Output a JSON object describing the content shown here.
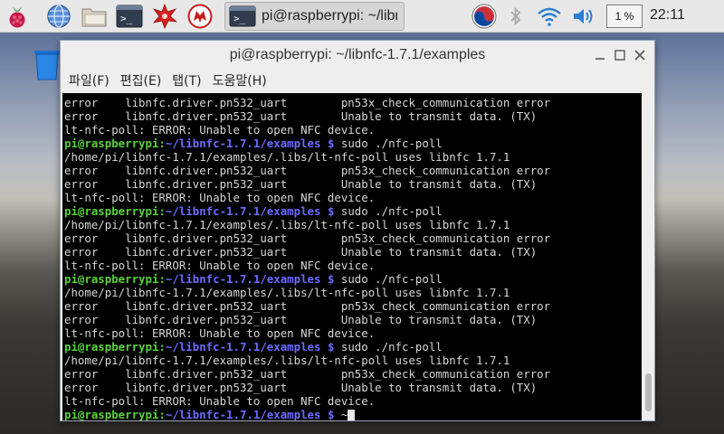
{
  "panel": {
    "task_title": "pi@raspberrypi: ~/libn",
    "cpu_label": "1 %",
    "clock": "22:11"
  },
  "window": {
    "title": "pi@raspberrypi: ~/libnfc-1.7.1/examples",
    "menu": [
      "파일(F)",
      "편집(E)",
      "탭(T)",
      "도움말(H)"
    ]
  },
  "terminal": {
    "lines": [
      {
        "type": "out",
        "text": "error    libnfc.driver.pn532_uart        pn53x_check_communication error"
      },
      {
        "type": "out",
        "text": "error    libnfc.driver.pn532_uart        Unable to transmit data. (TX)"
      },
      {
        "type": "out",
        "text": "lt-nfc-poll: ERROR: Unable to open NFC device."
      },
      {
        "type": "prompt",
        "user": "pi@raspberrypi",
        "path": "~/libnfc-1.7.1/examples",
        "cmd": " sudo ./nfc-poll"
      },
      {
        "type": "out",
        "text": "/home/pi/libnfc-1.7.1/examples/.libs/lt-nfc-poll uses libnfc 1.7.1"
      },
      {
        "type": "out",
        "text": "error    libnfc.driver.pn532_uart        pn53x_check_communication error"
      },
      {
        "type": "out",
        "text": "error    libnfc.driver.pn532_uart        Unable to transmit data. (TX)"
      },
      {
        "type": "out",
        "text": "lt-nfc-poll: ERROR: Unable to open NFC device."
      },
      {
        "type": "prompt",
        "user": "pi@raspberrypi",
        "path": "~/libnfc-1.7.1/examples",
        "cmd": " sudo ./nfc-poll"
      },
      {
        "type": "out",
        "text": "/home/pi/libnfc-1.7.1/examples/.libs/lt-nfc-poll uses libnfc 1.7.1"
      },
      {
        "type": "out",
        "text": "error    libnfc.driver.pn532_uart        pn53x_check_communication error"
      },
      {
        "type": "out",
        "text": "error    libnfc.driver.pn532_uart        Unable to transmit data. (TX)"
      },
      {
        "type": "out",
        "text": "lt-nfc-poll: ERROR: Unable to open NFC device."
      },
      {
        "type": "prompt",
        "user": "pi@raspberrypi",
        "path": "~/libnfc-1.7.1/examples",
        "cmd": " sudo ./nfc-poll"
      },
      {
        "type": "out",
        "text": "/home/pi/libnfc-1.7.1/examples/.libs/lt-nfc-poll uses libnfc 1.7.1"
      },
      {
        "type": "out",
        "text": "error    libnfc.driver.pn532_uart        pn53x_check_communication error"
      },
      {
        "type": "out",
        "text": "error    libnfc.driver.pn532_uart        Unable to transmit data. (TX)"
      },
      {
        "type": "out",
        "text": "lt-nfc-poll: ERROR: Unable to open NFC device."
      },
      {
        "type": "prompt",
        "user": "pi@raspberrypi",
        "path": "~/libnfc-1.7.1/examples",
        "cmd": " sudo ./nfc-poll"
      },
      {
        "type": "out",
        "text": "/home/pi/libnfc-1.7.1/examples/.libs/lt-nfc-poll uses libnfc 1.7.1"
      },
      {
        "type": "out",
        "text": "error    libnfc.driver.pn532_uart        pn53x_check_communication error"
      },
      {
        "type": "out",
        "text": "error    libnfc.driver.pn532_uart        Unable to transmit data. (TX)"
      },
      {
        "type": "out",
        "text": "lt-nfc-poll: ERROR: Unable to open NFC device."
      },
      {
        "type": "prompt",
        "user": "pi@raspberrypi",
        "path": "~/libnfc-1.7.1/examples",
        "cmd": " ~",
        "cursor": true
      }
    ]
  },
  "colors": {
    "prompt_user": "#5ad23c",
    "prompt_path": "#6b6bff",
    "terminal_bg": "#000000",
    "terminal_fg": "#d6d6d6"
  },
  "icons": {
    "panel": [
      "raspberry-menu-icon",
      "web-browser-icon",
      "file-manager-icon",
      "terminal-icon",
      "math-kernel-icon",
      "wolfram-icon"
    ],
    "tray": [
      "korean-input-icon",
      "bluetooth-icon",
      "wifi-icon",
      "volume-icon"
    ],
    "desktop": [
      "trash-icon"
    ]
  }
}
